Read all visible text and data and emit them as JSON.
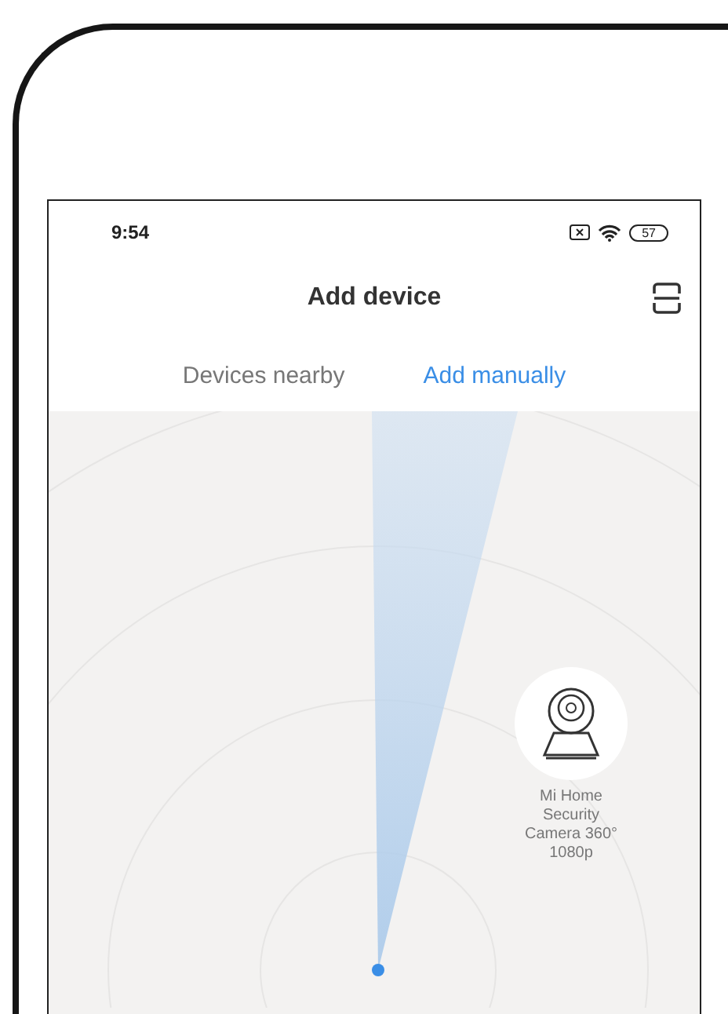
{
  "status_bar": {
    "time": "9:54",
    "battery": "57"
  },
  "header": {
    "title": "Add device"
  },
  "tabs": [
    {
      "label": "Devices nearby",
      "selected": false
    },
    {
      "label": "Add manually",
      "selected": true
    }
  ],
  "devices": [
    {
      "name": "Mi Home Security Camera 360° 1080p"
    }
  ]
}
